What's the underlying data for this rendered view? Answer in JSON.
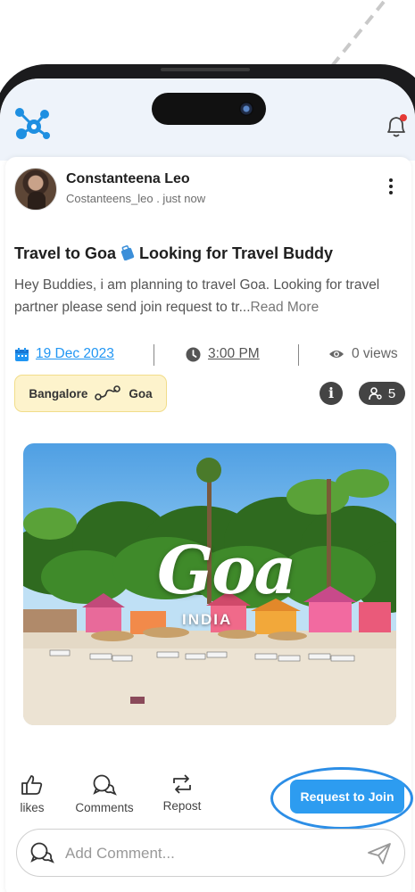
{
  "post": {
    "author_name": "Constanteena Leo",
    "author_handle": "Costanteens_leo",
    "time_ago": ". just now",
    "title_part1": "Travel to Goa",
    "title_part2": "Looking for Travel Buddy",
    "body": "Hey Buddies, i am planning to travel Goa. Looking for travel partner please send join request to tr...",
    "read_more": "Read More",
    "date": "19 Dec 2023",
    "time": "3:00 PM",
    "views": "0 views",
    "route_from": "Bangalore",
    "route_to": "Goa",
    "members_count": "5",
    "info_symbol": "i",
    "image": {
      "headline": "Goa",
      "subline": "INDIA"
    }
  },
  "actions": {
    "likes": "likes",
    "comments": "Comments",
    "repost": "Repost",
    "request_join": "Request to Join"
  },
  "comment": {
    "placeholder": "Add Comment..."
  },
  "colors": {
    "accent": "#2d9cf0",
    "chip_bg": "#fdf3cc",
    "pill_bg": "#444444",
    "notification_dot": "#e53935"
  },
  "icons": {
    "logo": "app-network-logo",
    "bell": "bell-icon",
    "calendar": "calendar-icon",
    "clock": "clock-icon",
    "eye": "eye-icon",
    "route": "route-icon",
    "info": "info-icon",
    "members": "members-icon",
    "like": "thumbs-up-icon",
    "comment": "comment-icon",
    "repost": "repost-icon",
    "send": "send-icon"
  }
}
